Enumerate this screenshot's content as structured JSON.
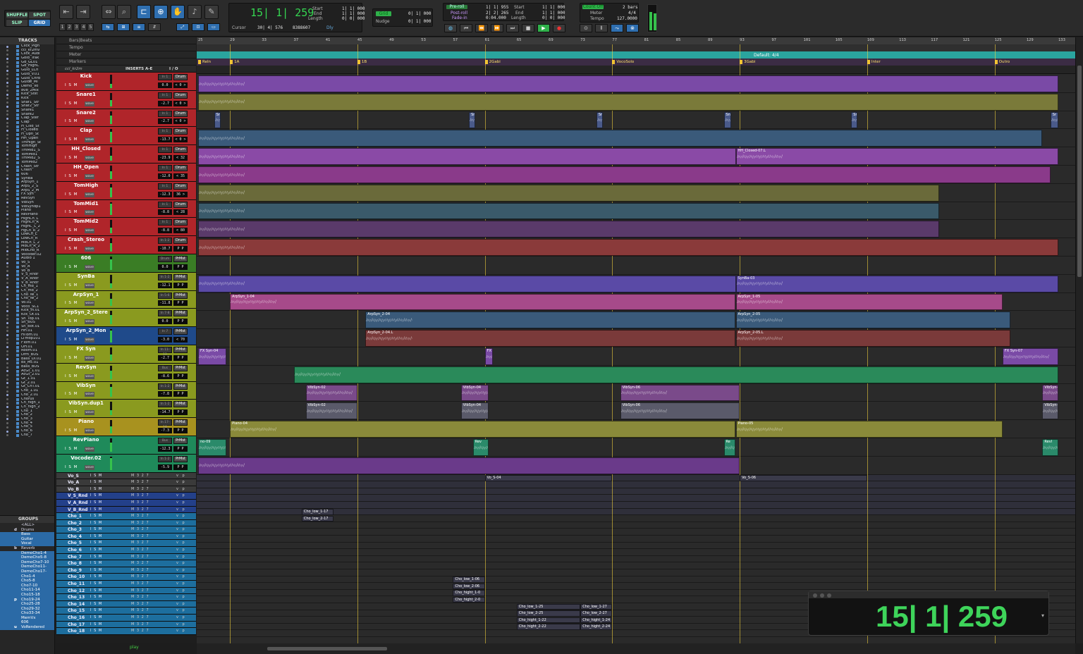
{
  "toolbar": {
    "modes": [
      "SHUFFLE",
      "SPOT",
      "SLIP",
      "GRID"
    ],
    "counter": "15| 1| 259",
    "cursor_label": "Cursor",
    "cursor_value": "30| 4| 576",
    "cursor_sample": "8388607",
    "dly_label": "Dly",
    "start_label": "Start",
    "end_label": "End",
    "length_label": "Length",
    "start_value": "1| 1| 000",
    "end_value": "1| 1| 000",
    "length_value": "0| 0| 000",
    "grid_label": "Grid",
    "grid_value": "0| 1| 000",
    "nudge_label": "Nudge",
    "nudge_value": "0| 1| 000",
    "preroll_label": "Pre-roll",
    "postroll_label": "Post-roll",
    "fadein_label": "Fade-in",
    "preroll_value": "1| 1| 955",
    "postroll_value": "2| 2| 265",
    "fadein_value": "0:04.000",
    "start2_value": "1| 1| 000",
    "end2_value": "1| 1| 000",
    "length2_value": "0| 0| 000",
    "countoff_label": "Count Off",
    "countoff_value": "2 bars",
    "meter_label": "Meter",
    "meter_value": "4/4",
    "tempo_label": "Tempo",
    "tempo_value": "127.0000",
    "numbers": [
      "1",
      "2",
      "3",
      "4",
      "5"
    ]
  },
  "tracklist": {
    "title": "TRACKS",
    "items": [
      "Click_Pign",
      "ccl_kr2mv",
      "Click_Audi",
      "Gold_Trak",
      "Gd_GL01",
      "Gd_HighC",
      "Guid_LCh",
      "Guid_V.01",
      "Guid_Chrd",
      "Guide_Ml",
      "Demo_Vo",
      "808_2Mix",
      "Kick_Stst",
      "Kick",
      "Snar1_Str",
      "Snar2_Str",
      "Snare1",
      "Snare2",
      "Clap_Ster",
      "Clap",
      "H_Clsd_St",
      "H_Closed",
      "H_Opn_St",
      "HH_Open",
      "TmHigh_St",
      "TomHigh",
      "TmMid1_S",
      "TomMid1",
      "TmMid2_S",
      "TomMid2",
      "Crash_Str",
      "Crash",
      "606",
      "SynBa",
      "ArpSyn_1",
      "ArpS_2_S",
      "ArpS_2_M",
      "FX Syn",
      "RevSyn",
      "VibSyn",
      "VibSyndp1",
      "Piano",
      "RevPiano",
      "HighCh_L",
      "HighCh_R",
      "HighC_L_2",
      "HgCh_R_2",
      "LowCh_L",
      "LowCh_R",
      "MdCh_L_2",
      "MdCh_R_2",
      "MidCho_R",
      "Vocoder.02",
      "Audio 1",
      "Vo_S",
      "Vo_A",
      "Vo_B",
      "V_S_Rndr",
      "V_A_Rndr",
      "V_B_Rndr",
      "Ch_md_1",
      "Ch_md_2",
      "Cho_lw_1",
      "Cho_lw_2",
      "Vo.01",
      "Voco_SC1",
      "Kick_In.01",
      "Kck_Ot.01",
      "Sn_Top.01",
      "Sn_BUS",
      "Sn_Bot.01",
      "HH.01",
      "HiTom.01",
      "LTmdp101",
      "FTom.01",
      "OH.01",
      "Room.01",
      "Drm_BUS",
      "Bass_DI.01",
      "Bs_Mc.01",
      "Bass_BUS",
      "AcGt_1.01",
      "AcGt_2.01",
      "Gt_1.01",
      "Gt_2.01",
      "Gt_ChT.01",
      "Cho_1.01",
      "Cho_2.01",
      "Chorus",
      "Ch_high_1",
      "Ch_high_2",
      "Cho_1",
      "Cho_2",
      "Cho_3",
      "Cho_4",
      "Cho_5",
      "Cho_6",
      "Cho_7"
    ]
  },
  "groups": {
    "title": "GROUPS",
    "items": [
      {
        "letter": "",
        "name": "<ALL>"
      },
      {
        "letter": "d",
        "name": "Drums"
      },
      {
        "letter": "",
        "name": "Bass"
      },
      {
        "letter": "",
        "name": "Guitar"
      },
      {
        "letter": "",
        "name": "Vocal"
      },
      {
        "letter": "b",
        "name": "Reverb"
      },
      {
        "letter": "",
        "name": "DemoCho1-4"
      },
      {
        "letter": "",
        "name": "DemoCho5-8"
      },
      {
        "letter": "",
        "name": "DemoCho7-10"
      },
      {
        "letter": "",
        "name": "DemoCho11-"
      },
      {
        "letter": "",
        "name": "DemoCho17-"
      },
      {
        "letter": "",
        "name": "Cho1-4"
      },
      {
        "letter": "",
        "name": "Cho5-8"
      },
      {
        "letter": "",
        "name": "Cho7-10"
      },
      {
        "letter": "",
        "name": "Cho11-14"
      },
      {
        "letter": "",
        "name": "Cho15-18"
      },
      {
        "letter": "p",
        "name": "Cho19-24"
      },
      {
        "letter": "",
        "name": "Cho25-28"
      },
      {
        "letter": "",
        "name": "Cho29-32"
      },
      {
        "letter": "",
        "name": "Cho33-34"
      },
      {
        "letter": "",
        "name": "MemVx"
      },
      {
        "letter": "",
        "name": "606"
      },
      {
        "letter": "u",
        "name": "VoRendered"
      }
    ]
  },
  "headers": {
    "ruler_labels": [
      "Bars|Beats",
      "Tempo",
      "Meter",
      "Markers"
    ],
    "col_inserts": "INSERTS A-E",
    "col_io": "I / O",
    "first_track": "ccl_kr2m",
    "tracks": [
      {
        "name": "Kick",
        "color": "#b0252a",
        "vol": "0.0",
        "pan": "< 0 >",
        "io": "Drum",
        "ins": "In 1"
      },
      {
        "name": "Snare1",
        "color": "#b0252a",
        "vol": "-2.7",
        "pan": "< 0 >",
        "io": "Drum",
        "ins": "In 1"
      },
      {
        "name": "Snare2",
        "color": "#b0252a",
        "vol": "-2.7",
        "pan": "< 0 >",
        "io": "Drum",
        "ins": "In 1"
      },
      {
        "name": "Clap",
        "color": "#b0252a",
        "vol": "-13.7",
        "pan": "< 0 >",
        "io": "Drum",
        "ins": "In 1"
      },
      {
        "name": "HH_Closed",
        "color": "#b0252a",
        "vol": "-23.9",
        "pan": "< 32",
        "io": "Drum",
        "ins": "In 1"
      },
      {
        "name": "HH_Open",
        "color": "#b0252a",
        "vol": "-12.0",
        "pan": "< 35",
        "io": "Drum",
        "ins": "In 1"
      },
      {
        "name": "TomHigh",
        "color": "#b0252a",
        "vol": "-12.3",
        "pan": "36 >",
        "io": "Drum",
        "ins": "In 1"
      },
      {
        "name": "TomMid1",
        "color": "#b0252a",
        "vol": "-8.8",
        "pan": "< 28",
        "io": "Drum",
        "ins": "In 1"
      },
      {
        "name": "TomMid2",
        "color": "#b0252a",
        "vol": "-8.8",
        "pan": "< 80",
        "io": "Drum",
        "ins": "In 1"
      },
      {
        "name": "Crash_Stereo",
        "color": "#b0252a",
        "vol": "-10.7",
        "pan": "P P",
        "io": "Drum",
        "ins": "In 1-2"
      },
      {
        "name": "606",
        "color": "#3a7d25",
        "vol": "0.0",
        "pan": "P P",
        "io": "PrMst",
        "ins": "Drum"
      },
      {
        "name": "SynBa",
        "color": "#8a9a1f",
        "vol": "-12.1",
        "pan": "P P",
        "io": "PrMst",
        "ins": "In 1-2"
      },
      {
        "name": "ArpSyn_1",
        "color": "#8a9a1f",
        "vol": "-11.8",
        "pan": "P P",
        "io": "PrMst",
        "ins": "In 5-6"
      },
      {
        "name": "ArpSyn_2_Stere",
        "color": "#8a9a1f",
        "vol": "0.0",
        "pan": "P P",
        "io": "PrMst",
        "ins": "In 7-8"
      },
      {
        "name": "ArpSyn_2_Mon",
        "color": "#1f4a8a",
        "vol": "-3.0",
        "pan": "< 70",
        "io": "PrMst",
        "ins": "In 7"
      },
      {
        "name": "FX Syn",
        "color": "#8a9a1f",
        "vol": "-2.7",
        "pan": "P P",
        "io": "PrMst",
        "ins": "In 11-12"
      },
      {
        "name": "RevSyn",
        "color": "#8a9a1f",
        "vol": "-8.6",
        "pan": "P P",
        "io": "PrMst",
        "ins": "Bus"
      },
      {
        "name": "VibSyn",
        "color": "#8a9a1f",
        "vol": "-7.8",
        "pan": "P P",
        "io": "PrMst",
        "ins": "In 1-2"
      },
      {
        "name": "VibSyn.dup1",
        "color": "#8a9a1f",
        "vol": "-14.7",
        "pan": "P P",
        "io": "PrMst",
        "ins": "In 1-2"
      },
      {
        "name": "Piano",
        "color": "#a8921f",
        "vol": "-7.3",
        "pan": "P P",
        "io": "PrMst",
        "ins": "In 17-18"
      },
      {
        "name": "RevPiano",
        "color": "#1f8a5a",
        "vol": "-12.3",
        "pan": "P P",
        "io": "PrMst",
        "ins": "Bus"
      },
      {
        "name": "Vocoder.02",
        "color": "#1f8a5a",
        "vol": "-5.9",
        "pan": "P P",
        "io": "PrMst",
        "ins": "In 1-2"
      }
    ],
    "slim_tracks": [
      {
        "name": "Vo_S",
        "color": "#3a3a3a"
      },
      {
        "name": "Vo_A",
        "color": "#3a3a3a"
      },
      {
        "name": "Vo_B",
        "color": "#3a3a3a"
      },
      {
        "name": "V_S_Rnd",
        "color": "#23408a"
      },
      {
        "name": "V_A_Rnd",
        "color": "#23408a"
      },
      {
        "name": "V_B_Rnd",
        "color": "#23408a"
      },
      {
        "name": "Cho_1",
        "color": "#1d6e9e"
      },
      {
        "name": "Cho_2",
        "color": "#1d6e9e"
      },
      {
        "name": "Cho_3",
        "color": "#1d6e9e"
      },
      {
        "name": "Cho_4",
        "color": "#1d6e9e"
      },
      {
        "name": "Cho_5",
        "color": "#1d6e9e"
      },
      {
        "name": "Cho_6",
        "color": "#1d6e9e"
      },
      {
        "name": "Cho_7",
        "color": "#1d6e9e"
      },
      {
        "name": "Cho_8",
        "color": "#1d6e9e"
      },
      {
        "name": "Cho_9",
        "color": "#1d6e9e"
      },
      {
        "name": "Cho_10",
        "color": "#1d6e9e"
      },
      {
        "name": "Cho_11",
        "color": "#1d6e9e"
      },
      {
        "name": "Cho_12",
        "color": "#1d6e9e"
      },
      {
        "name": "Cho_13",
        "color": "#1d6e9e"
      },
      {
        "name": "Cho_14",
        "color": "#1d6e9e"
      },
      {
        "name": "Cho_15",
        "color": "#1d6e9e"
      },
      {
        "name": "Cho_16",
        "color": "#1d6e9e"
      },
      {
        "name": "Cho_17",
        "color": "#1d6e9e"
      },
      {
        "name": "Cho_18",
        "color": "#1d6e9e"
      }
    ],
    "ism": "I S M",
    "wave": "wave",
    "vp": "v p",
    "snums": "M 3 2 7"
  },
  "timeline": {
    "bar_numbers": [
      "25",
      "29",
      "33",
      "37",
      "41",
      "45",
      "49",
      "53",
      "57",
      "61",
      "65",
      "69",
      "73",
      "77",
      "81",
      "85",
      "89",
      "93",
      "97",
      "101",
      "105",
      "109",
      "113",
      "117",
      "121",
      "125",
      "129",
      "133"
    ],
    "meter_text": "Default: 4/4",
    "markers": [
      {
        "name": "ReIn",
        "bar": 25
      },
      {
        "name": "1A",
        "bar": 29
      },
      {
        "name": "1B",
        "bar": 45
      },
      {
        "name": "2Gabi",
        "bar": 61
      },
      {
        "name": "VocoSolo",
        "bar": 77
      },
      {
        "name": "3Gabi",
        "bar": 93
      },
      {
        "name": "Inter",
        "bar": 109
      },
      {
        "name": "Outro",
        "bar": 125
      }
    ],
    "clips": [
      {
        "lane": 0,
        "name": "",
        "start": 25,
        "end": 133,
        "color": "#7a4aa6"
      },
      {
        "lane": 1,
        "name": "",
        "start": 25,
        "end": 133,
        "color": "#7a7a3a"
      },
      {
        "lane": 2,
        "name": "Sr",
        "start": 27,
        "end": 27.8,
        "color": "#4a5a8a"
      },
      {
        "lane": 2,
        "name": "Sr",
        "start": 59,
        "end": 59.8,
        "color": "#4a5a8a"
      },
      {
        "lane": 2,
        "name": "Sr",
        "start": 75,
        "end": 75.8,
        "color": "#4a5a8a"
      },
      {
        "lane": 2,
        "name": "Snu",
        "start": 91,
        "end": 91.9,
        "color": "#4a5a8a"
      },
      {
        "lane": 2,
        "name": "Sr",
        "start": 107,
        "end": 107.8,
        "color": "#4a5a8a"
      },
      {
        "lane": 2,
        "name": "Sr",
        "start": 132,
        "end": 133,
        "color": "#4a5a8a"
      },
      {
        "lane": 3,
        "name": "",
        "start": 25,
        "end": 131,
        "color": "#3a5a7a"
      },
      {
        "lane": 4,
        "name": "",
        "start": 25,
        "end": 92.5,
        "color": "#8a4aa6"
      },
      {
        "lane": 4,
        "name": "HH_Closed-07.L",
        "start": 92.5,
        "end": 133,
        "color": "#8a4aa6"
      },
      {
        "lane": 5,
        "name": "",
        "start": 25,
        "end": 132,
        "color": "#8a3a8a"
      },
      {
        "lane": 6,
        "name": "",
        "start": 25,
        "end": 118,
        "color": "#6a6a3a"
      },
      {
        "lane": 7,
        "name": "",
        "start": 25,
        "end": 118,
        "color": "#3a5a6a"
      },
      {
        "lane": 8,
        "name": "",
        "start": 25,
        "end": 118,
        "color": "#5a3a6a"
      },
      {
        "lane": 9,
        "name": "",
        "start": 25,
        "end": 133,
        "color": "#8a3a3a"
      },
      {
        "lane": 11,
        "name": "",
        "start": 25,
        "end": 92.5,
        "color": "#5a4aa6"
      },
      {
        "lane": 11,
        "name": "SynBa-03",
        "start": 92.5,
        "end": 133,
        "color": "#5a4aa6"
      },
      {
        "lane": 12,
        "name": "ArpSyn_1-04",
        "start": 29,
        "end": 92.5,
        "color": "#a64a8a"
      },
      {
        "lane": 12,
        "name": "ArpSyn_1-05",
        "start": 92.5,
        "end": 126,
        "color": "#a64a8a"
      },
      {
        "lane": 13,
        "name": "ArpSyn_2-04",
        "start": 46,
        "end": 92.5,
        "color": "#3a5a7a"
      },
      {
        "lane": 13,
        "name": "ArpSyn_2-05",
        "start": 92.5,
        "end": 127,
        "color": "#3a5a7a"
      },
      {
        "lane": 14,
        "name": "ArpSyn_2-04.L",
        "start": 46,
        "end": 92.5,
        "color": "#7a3a3a"
      },
      {
        "lane": 14,
        "name": "ArpSyn_2-05.L",
        "start": 92.5,
        "end": 127,
        "color": "#7a3a3a"
      },
      {
        "lane": 15,
        "name": "FX Syn-04",
        "start": 25,
        "end": 28.5,
        "color": "#7a4aa6"
      },
      {
        "lane": 15,
        "name": "FX",
        "start": 61,
        "end": 62,
        "color": "#7a4aa6"
      },
      {
        "lane": 15,
        "name": "FX Syn-07",
        "start": 126,
        "end": 133,
        "color": "#7a4aa6"
      },
      {
        "lane": 16,
        "name": "",
        "start": 37,
        "end": 133,
        "color": "#2a8a5a"
      },
      {
        "lane": 17,
        "name": "VibSyn-02",
        "start": 38.5,
        "end": 45,
        "color": "#7a4a8a"
      },
      {
        "lane": 17,
        "name": "VibSyn-04",
        "start": 58,
        "end": 61.5,
        "color": "#7a4a8a"
      },
      {
        "lane": 17,
        "name": "VibSyn-06",
        "start": 78,
        "end": 93,
        "color": "#7a4a8a"
      },
      {
        "lane": 17,
        "name": "VibSyn-l",
        "start": 131,
        "end": 133,
        "color": "#7a4a8a"
      },
      {
        "lane": 18,
        "name": "VibSyn-02",
        "start": 38.5,
        "end": 45,
        "color": "#5a5a6a"
      },
      {
        "lane": 18,
        "name": "VibSyn-04",
        "start": 58,
        "end": 61.5,
        "color": "#5a5a6a"
      },
      {
        "lane": 18,
        "name": "VibSyn-06",
        "start": 78,
        "end": 93,
        "color": "#5a5a6a"
      },
      {
        "lane": 18,
        "name": "VibSyn-l",
        "start": 131,
        "end": 133,
        "color": "#5a5a6a"
      },
      {
        "lane": 19,
        "name": "Piano-04",
        "start": 29,
        "end": 92.5,
        "color": "#8a8a3a"
      },
      {
        "lane": 19,
        "name": "Piano-05",
        "start": 92.5,
        "end": 126,
        "color": "#8a8a3a"
      },
      {
        "lane": 20,
        "name": "no-09",
        "start": 25,
        "end": 28.5,
        "color": "#2a8a6a"
      },
      {
        "lane": 20,
        "name": "Rev",
        "start": 59.5,
        "end": 61.5,
        "color": "#2a8a6a"
      },
      {
        "lane": 20,
        "name": "Re",
        "start": 91,
        "end": 92.5,
        "color": "#2a8a6a"
      },
      {
        "lane": 20,
        "name": "Revl",
        "start": 131,
        "end": 133,
        "color": "#2a8a6a"
      },
      {
        "lane": 21,
        "name": "",
        "start": 25,
        "end": 93,
        "color": "#6a3a8a"
      }
    ],
    "slim_clips": [
      {
        "row": 0,
        "name": "Vo_S-04",
        "start": 61,
        "end": 77
      },
      {
        "row": 0,
        "name": "Vo_S-06",
        "start": 93,
        "end": 109
      },
      {
        "row": 5,
        "name": "Cho_low_1-17",
        "start": 38,
        "end": 42
      },
      {
        "row": 6,
        "name": "Cho_low_2-17",
        "start": 38,
        "end": 42
      },
      {
        "row": 15,
        "name": "Cho_low_1-06",
        "start": 57,
        "end": 61
      },
      {
        "row": 16,
        "name": "Cho_low_2-06",
        "start": 57,
        "end": 61
      },
      {
        "row": 17,
        "name": "Cho_hight_1-0",
        "start": 57,
        "end": 61
      },
      {
        "row": 18,
        "name": "Cho_hight_2-0",
        "start": 57,
        "end": 61
      },
      {
        "row": 19,
        "name": "Cho_low_1-25",
        "start": 65,
        "end": 73
      },
      {
        "row": 20,
        "name": "Cho_low_2-25",
        "start": 65,
        "end": 73
      },
      {
        "row": 21,
        "name": "Cho_hight_1-22",
        "start": 65,
        "end": 73
      },
      {
        "row": 22,
        "name": "Cho_hight_2-22",
        "start": 65,
        "end": 73
      },
      {
        "row": 19,
        "name": "Cho_low_1-27",
        "start": 73,
        "end": 77
      },
      {
        "row": 20,
        "name": "Cho_low_2-27",
        "start": 73,
        "end": 77
      },
      {
        "row": 21,
        "name": "Cho_hight_1-24",
        "start": 73,
        "end": 77
      },
      {
        "row": 22,
        "name": "Cho_hight_2-24",
        "start": 73,
        "end": 77
      }
    ]
  },
  "big_counter": "15| 1| 259",
  "play_label": "play"
}
